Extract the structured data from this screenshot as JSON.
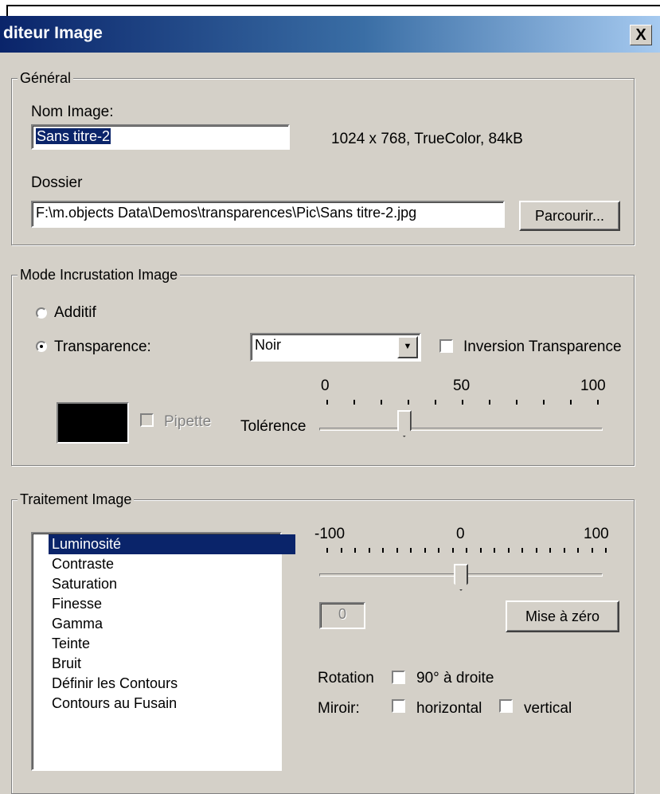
{
  "window": {
    "title": "diteur Image",
    "close_label": "X"
  },
  "general": {
    "legend": "Général",
    "name_label": "Nom Image:",
    "name_value": "Sans titre-2",
    "image_info": "1024 x 768, TrueColor, 84kB",
    "folder_label": "Dossier",
    "folder_value": "F:\\m.objects Data\\Demos\\transparences\\Pic\\Sans titre-2.jpg",
    "browse_label": "Parcourir..."
  },
  "blend": {
    "legend": "Mode Incrustation Image",
    "additive_label": "Additif",
    "additive_selected": false,
    "transparency_label": "Transparence:",
    "transparency_selected": true,
    "color_value": "Noir",
    "invert_label": "Inversion Transparence",
    "invert_checked": false,
    "eyedropper_label": "Pipette",
    "tolerance_label": "Tolérence",
    "tolerance_ticks": [
      "0",
      "50",
      "100"
    ],
    "tolerance_value": 30,
    "swatch_color": "#000000"
  },
  "processing": {
    "legend": "Traitement Image",
    "items": [
      "Luminosité",
      "Contraste",
      "Saturation",
      "Finesse",
      "Gamma",
      "Teinte",
      "Bruit",
      "Définir les Contours",
      "Contours au Fusain"
    ],
    "selected_index": 0,
    "slider_ticks": [
      "-100",
      "0",
      "100"
    ],
    "slider_value": 0,
    "value_field": "0",
    "reset_label": "Mise à zéro",
    "rotation_label": "Rotation",
    "rotate_right_label": "90° à droite",
    "mirror_label": "Miroir:",
    "horizontal_label": "horizontal",
    "vertical_label": "vertical"
  },
  "colors": {
    "title_bar_start": "#0a246a",
    "title_bar_end": "#a6caf0",
    "dialog_bg": "#d4d0c8",
    "selection": "#0a246a"
  }
}
